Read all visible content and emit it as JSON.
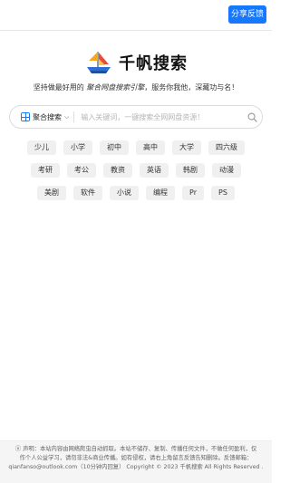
{
  "header": {
    "share_label": "分享反馈"
  },
  "brand": {
    "name": "千帆搜索"
  },
  "tagline": {
    "prefix": "坚持做最好用的 ",
    "highlight": "聚合网盘搜索引擎",
    "suffix": "，服务你我他，深藏功与名！"
  },
  "search": {
    "scope_label": "聚合搜索",
    "placeholder": "输入关键词，一键搜索全网网盘资源！"
  },
  "tags": [
    "少儿",
    "小学",
    "初中",
    "高中",
    "大学",
    "四六级",
    "考研",
    "考公",
    "教资",
    "英语",
    "韩剧",
    "动漫",
    "美剧",
    "软件",
    "小说",
    "编程",
    "Pr",
    "PS"
  ],
  "footer": {
    "line1": "声明：本站内容由网络爬虫自动抓取。本站不储存、复制、传播任何文件，不做任何盈利，仅",
    "line2": "作个人公益学习，请勿非法&商业传播。如有侵权，请右上角留言反馈告知删除。反馈邮箱：",
    "line3": "qianfanso@outlook.com（10分钟内回复） Copyright © 2023 千帆搜索 All Rights Reserved ."
  },
  "colors": {
    "accent": "#1677ff",
    "tag_bg": "#f0f0f0"
  }
}
